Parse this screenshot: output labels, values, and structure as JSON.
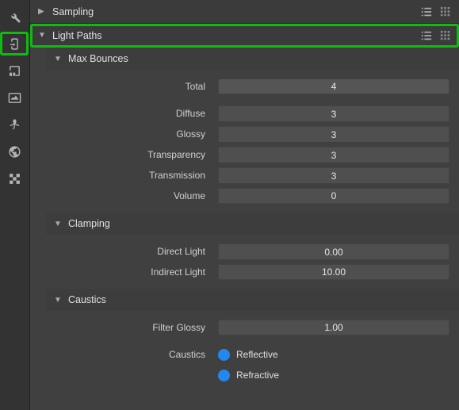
{
  "sidebar_icons": [
    "wrench",
    "scene",
    "output",
    "image",
    "histogram",
    "world",
    "checker"
  ],
  "panels": {
    "sampling": {
      "label": "Sampling",
      "expanded": false
    },
    "light_paths": {
      "label": "Light Paths",
      "expanded": true
    }
  },
  "max_bounces": {
    "header": "Max Bounces",
    "total_label": "Total",
    "total_value": "4",
    "diffuse_label": "Diffuse",
    "diffuse_value": "3",
    "glossy_label": "Glossy",
    "glossy_value": "3",
    "transparency_label": "Transparency",
    "transparency_value": "3",
    "transmission_label": "Transmission",
    "transmission_value": "3",
    "volume_label": "Volume",
    "volume_value": "0"
  },
  "clamping": {
    "header": "Clamping",
    "direct_label": "Direct Light",
    "direct_value": "0.00",
    "indirect_label": "Indirect Light",
    "indirect_value": "10.00"
  },
  "caustics": {
    "header": "Caustics",
    "filter_label": "Filter Glossy",
    "filter_value": "1.00",
    "check_label": "Caustics",
    "reflective_label": "Reflective",
    "refractive_label": "Refractive"
  }
}
